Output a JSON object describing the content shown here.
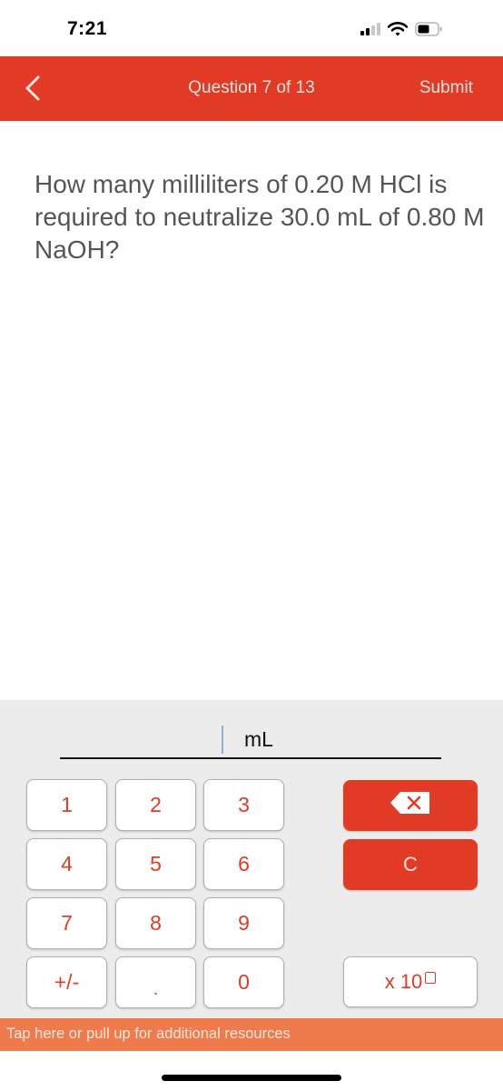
{
  "status_bar": {
    "time": "7:21",
    "icons": [
      "cellular-signal-icon",
      "wifi-icon",
      "battery-icon"
    ]
  },
  "header": {
    "title": "Question 7 of 13",
    "submit_label": "Submit",
    "back_icon": "chevron-left-icon"
  },
  "question": {
    "text": "How many milliliters of 0.20 M HCl is required to neutralize 30.0 mL of 0.80 M NaOH?"
  },
  "answer": {
    "value": "",
    "unit": "mL"
  },
  "keypad": {
    "keys": [
      "1",
      "2",
      "3",
      "4",
      "5",
      "6",
      "7",
      "8",
      "9",
      "+/-",
      ".",
      "0"
    ],
    "backspace_icon": "backspace-icon",
    "clear_label": "C",
    "sci_label": "x 10"
  },
  "resources_bar": {
    "text": "Tap here or pull up for additional resources"
  },
  "colors": {
    "accent": "#e23b25",
    "resources_bar": "#ef7a4c",
    "keypad_bg": "#ececec",
    "question_text": "#555555"
  }
}
